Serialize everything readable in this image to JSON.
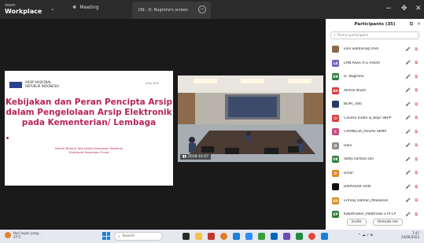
{
  "titlebar": {
    "brand_line1": "zoom",
    "brand_line2": "Workplace",
    "meeting_label": "Meeting",
    "tab_label": "DN - D. Nugroho's screen",
    "minimize": "−",
    "maximize": "✥",
    "close": "✕"
  },
  "slide": {
    "org_line1": "ARSIP NASIONAL",
    "org_line2": "REPUBLIK INDONESIA",
    "right_label": "Arsip NAS",
    "title": "Kebijakan dan Peran Pencipta Arsip dalam Pengelolaan Arsip Elektronik pada Kementerian/ Lembaga",
    "subtitle_line1": "Deputi Bidang Tata Kelola Kearsipan Nasional",
    "subtitle_line2": "Direktorat Kearsipan Pusat"
  },
  "video": {
    "label": "2018-10-07"
  },
  "participants": {
    "title": "Participants (35)",
    "search_placeholder": "Find a participant",
    "items": [
      {
        "name": "Ellis Saldianaq (me)",
        "initials": "",
        "color": "#8a6a4e",
        "icons": "🎤 ⧉"
      },
      {
        "name": "LAN Akan A.G (Host)",
        "initials": "LA",
        "color": "#7a5cc7",
        "icons": "🎤 ⧉"
      },
      {
        "name": "D. Nugroho",
        "initials": "DN",
        "color": "#2f7d3a",
        "icons": "🎤 ⧉"
      },
      {
        "name": "Akmal Ilham",
        "initials": "AH",
        "color": "#d93c3c",
        "icons": "🎤 ⧉"
      },
      {
        "name": "BLPR_Tato",
        "initials": "",
        "color": "#2b3a67",
        "icons": "🎤 ⧉"
      },
      {
        "name": "Candra Indah D_Kepr SKPP",
        "initials": "CI",
        "color": "#d93c3c",
        "icons": "🎤 ⧉"
      },
      {
        "name": "CARMELIA_PUSAR SKMP",
        "initials": "C",
        "color": "#c64b7a",
        "icons": "🎤 ⧉"
      },
      {
        "name": "Dani",
        "initials": "D",
        "color": "#8f8f8f",
        "icons": "🎤 ⧉"
      },
      {
        "name": "dotty kartika sari",
        "initials": "DK",
        "color": "#2f7d3a",
        "icons": "🎤 ⧉"
      },
      {
        "name": "Dinar",
        "initials": "D",
        "color": "#e08a22",
        "icons": "🎤 ⧉"
      },
      {
        "name": "DISPUSAR UAN",
        "initials": "",
        "color": "#111111",
        "icons": "🎤 ⧉"
      },
      {
        "name": "Ermaly Dahlan_Makassar",
        "initials": "ED",
        "color": "#e08a22",
        "icons": "🎤 ⧉"
      },
      {
        "name": "Kabatnaker_Polbtrosik ETA LAN...",
        "initials": "KP",
        "color": "#2f7d3a",
        "icons": "🎤 ⧉"
      }
    ],
    "invite_label": "Invite",
    "unmute_label": "Unmute me"
  },
  "taskbar": {
    "weather_line1": "Hari hujan yang...",
    "weather_line2": "27°C",
    "search_label": "Search",
    "time": "7:47",
    "date": "24/06/2023",
    "tray": "^ ☁ ♪ ⊕"
  }
}
